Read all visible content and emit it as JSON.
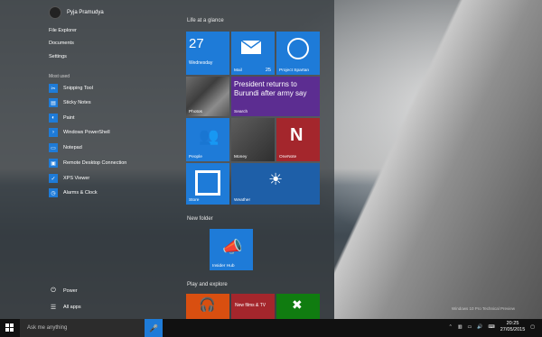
{
  "user": {
    "name": "Pyja Pramudya"
  },
  "places": [
    "File Explorer",
    "Documents",
    "Settings"
  ],
  "most_used_title": "Most used",
  "apps": [
    {
      "label": "Snipping Tool",
      "icon": "scissors-icon"
    },
    {
      "label": "Sticky Notes",
      "icon": "note-icon"
    },
    {
      "label": "Paint",
      "icon": "palette-icon"
    },
    {
      "label": "Windows PowerShell",
      "icon": "terminal-icon"
    },
    {
      "label": "Notepad",
      "icon": "notepad-icon"
    },
    {
      "label": "Remote Desktop Connection",
      "icon": "remote-desktop-icon"
    },
    {
      "label": "XPS Viewer",
      "icon": "document-icon"
    },
    {
      "label": "Alarms & Clock",
      "icon": "clock-icon"
    }
  ],
  "power_label": "Power",
  "all_apps_label": "All apps",
  "tiles": {
    "group1_title": "Life at a glance",
    "calendar": {
      "day": "27",
      "weekday": "Wednesday"
    },
    "mail": {
      "label": "Mail",
      "count": "25"
    },
    "project_spartan": {
      "label": "Project Spartan"
    },
    "photos": {
      "label": "Photos"
    },
    "news": {
      "headline": "President returns to Burundi after army say",
      "label": "Search"
    },
    "people": {
      "label": "People"
    },
    "money": {
      "label": "Money"
    },
    "onenote": {
      "label": "OneNote"
    },
    "store": {
      "label": "Store"
    },
    "weather": {
      "label": "Weather"
    },
    "group2_title": "New folder",
    "insider_hub": {
      "label": "Insider Hub"
    },
    "group3_title": "Play and explore",
    "music": {
      "label": ""
    },
    "news_tv": {
      "label": "New films & TV"
    },
    "xbox": {
      "label": "Xbox"
    }
  },
  "taskbar": {
    "search_placeholder": "Ask me anything",
    "time": "20:25",
    "date": "27/05/2015",
    "watermark": "Windows 10 Pro Technical Preview"
  },
  "colors": {
    "accent": "#1e7bd8",
    "purple": "#5c2d91",
    "red": "#c72c2c",
    "green": "#107c10"
  }
}
